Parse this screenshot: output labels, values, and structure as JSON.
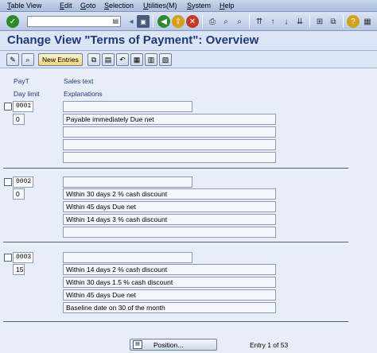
{
  "menu": [
    "Table View",
    "Edit",
    "Goto",
    "Selection",
    "Utilities(M)",
    "System",
    "Help"
  ],
  "toolbar": {
    "command_value": ""
  },
  "title": "Change View \"Terms of Payment\": Overview",
  "appbar": {
    "new_entries": "New Entries"
  },
  "headers": {
    "payt": "PayT",
    "sales_text": "Sales text",
    "day_limit": "Day limit",
    "explanations": "Explanations"
  },
  "entries": [
    {
      "payt": "0001",
      "day_limit": "0",
      "sales_text": "",
      "explanations": [
        "Payable immediately Due net",
        "",
        "",
        ""
      ]
    },
    {
      "payt": "0002",
      "day_limit": "0",
      "sales_text": "",
      "explanations": [
        "Within 30 days 2 % cash discount",
        "Within 45 days Due net",
        "Within 14 days 3 % cash discount",
        ""
      ]
    },
    {
      "payt": "0003",
      "day_limit": "15",
      "sales_text": "",
      "explanations": [
        "Within 14 days 2 % cash discount",
        "Within 30 days 1.5 % cash discount",
        "Within 45 days Due net",
        "Baseline date on 30 of the month"
      ]
    }
  ],
  "footer": {
    "position_label": "Position...",
    "entry_info": "Entry 1 of 53"
  }
}
